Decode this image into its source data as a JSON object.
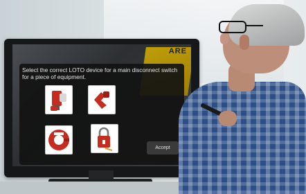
{
  "dialog": {
    "prompt": "Select the correct LOTO device for a main disconnect switch for a piece of equipment.",
    "options": [
      {
        "icon": "breaker-lockout-icon"
      },
      {
        "icon": "switch-lockout-icon"
      },
      {
        "icon": "valve-lockout-icon"
      },
      {
        "icon": "padlock-icon"
      }
    ],
    "accept_label": "Accept"
  },
  "background_sign": "ARE",
  "colors": {
    "dialog_bg": "#121212",
    "accept_bg": "#3a3a3a",
    "lockout_red": "#c62b1f",
    "shirt_blue": "#2d4f86"
  }
}
